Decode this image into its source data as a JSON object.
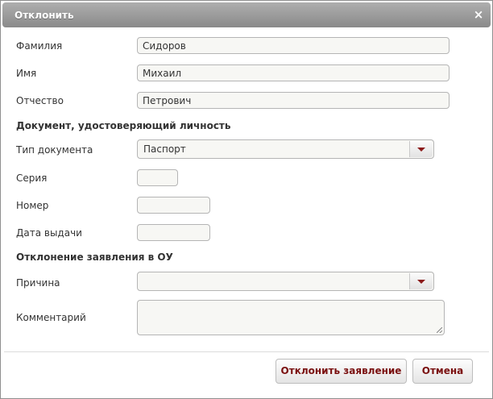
{
  "dialog": {
    "title": "Отклонить",
    "close_glyph": "×"
  },
  "form": {
    "last_name": {
      "label": "Фамилия",
      "value": "Сидоров"
    },
    "first_name": {
      "label": "Имя",
      "value": "Михаил"
    },
    "patronymic": {
      "label": "Отчество",
      "value": "Петрович"
    },
    "identity_section": "Документ, удостоверяющий личность",
    "doc_type": {
      "label": "Тип документа",
      "value": "Паспорт"
    },
    "series": {
      "label": "Серия",
      "value": ""
    },
    "number": {
      "label": "Номер",
      "value": ""
    },
    "issue_date": {
      "label": "Дата выдачи",
      "value": ""
    },
    "rejection_section": "Отклонение заявления в ОУ",
    "reason": {
      "label": "Причина",
      "value": ""
    },
    "comment": {
      "label": "Комментарий",
      "value": ""
    }
  },
  "buttons": {
    "reject": "Отклонить заявление",
    "cancel": "Отмена"
  },
  "icons": {
    "close": "close-icon",
    "dropdown": "chevron-down-icon",
    "resize": "resize-grip-icon"
  },
  "colors": {
    "titlebar": "#9a9a9a",
    "button_text": "#7a1010",
    "dropdown_arrow": "#8b1a1a",
    "field_bg": "#f7f7f4"
  }
}
